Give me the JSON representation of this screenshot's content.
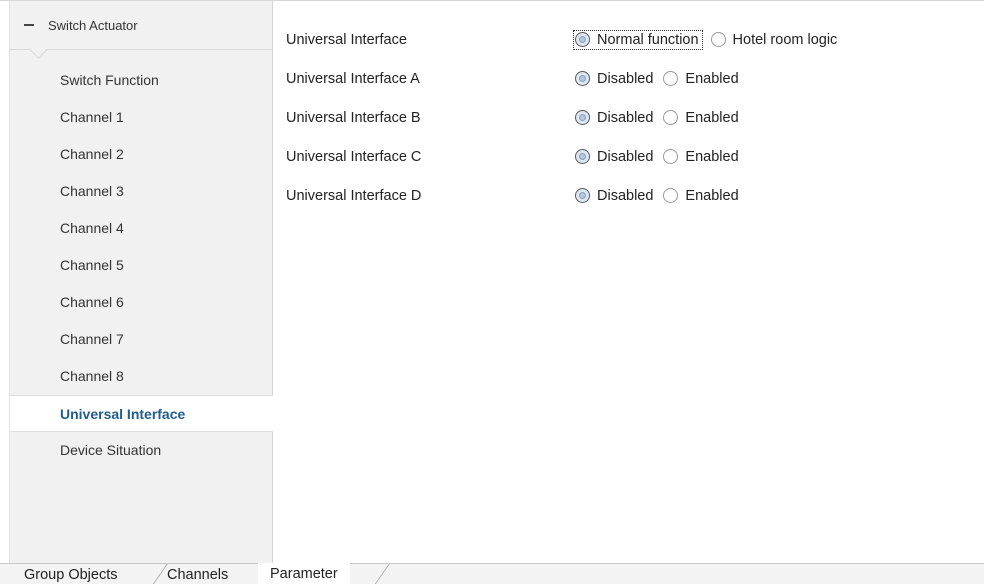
{
  "sidebar": {
    "header": "Switch Actuator",
    "items": [
      {
        "label": "Switch Function"
      },
      {
        "label": "Channel 1"
      },
      {
        "label": "Channel 2"
      },
      {
        "label": "Channel 3"
      },
      {
        "label": "Channel 4"
      },
      {
        "label": "Channel 5"
      },
      {
        "label": "Channel 6"
      },
      {
        "label": "Channel 7"
      },
      {
        "label": "Channel 8"
      },
      {
        "label": "Universal Interface",
        "active": true
      },
      {
        "label": "Device Situation"
      }
    ]
  },
  "parameters": [
    {
      "label": "Universal Interface",
      "options": [
        "Normal function",
        "Hotel room logic"
      ],
      "selected": "Normal function"
    },
    {
      "label": "Universal Interface A",
      "options": [
        "Disabled",
        "Enabled"
      ],
      "selected": "Disabled"
    },
    {
      "label": "Universal Interface B",
      "options": [
        "Disabled",
        "Enabled"
      ],
      "selected": "Disabled"
    },
    {
      "label": "Universal Interface C",
      "options": [
        "Disabled",
        "Enabled"
      ],
      "selected": "Disabled"
    },
    {
      "label": "Universal Interface D",
      "options": [
        "Disabled",
        "Enabled"
      ],
      "selected": "Disabled"
    }
  ],
  "tabs": [
    {
      "label": "Group Objects"
    },
    {
      "label": "Channels"
    },
    {
      "label": "Parameter",
      "active": true
    }
  ],
  "icons": {
    "collapse": "minus-icon",
    "radio_selected": "radio-selected-icon",
    "radio_unselected": "radio-unselected-icon"
  }
}
